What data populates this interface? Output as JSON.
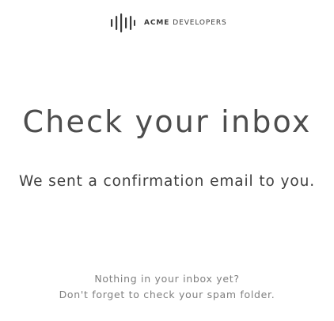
{
  "brand": {
    "name_bold": "ACME",
    "name_rest": "DEVELOPERS",
    "logo_icon": "sound-bars-icon",
    "logo_color": "#3a3a3a"
  },
  "main": {
    "title": "Check your inbox",
    "subtitle": "We sent a confirmation email to you."
  },
  "footer": {
    "line1": "Nothing in your inbox yet?",
    "line2": "Don't forget to check your spam folder."
  },
  "colors": {
    "background": "#ffffff",
    "title": "#4d4d4d",
    "body_text": "#3e3e3e",
    "muted_text": "#7f7f7f"
  }
}
